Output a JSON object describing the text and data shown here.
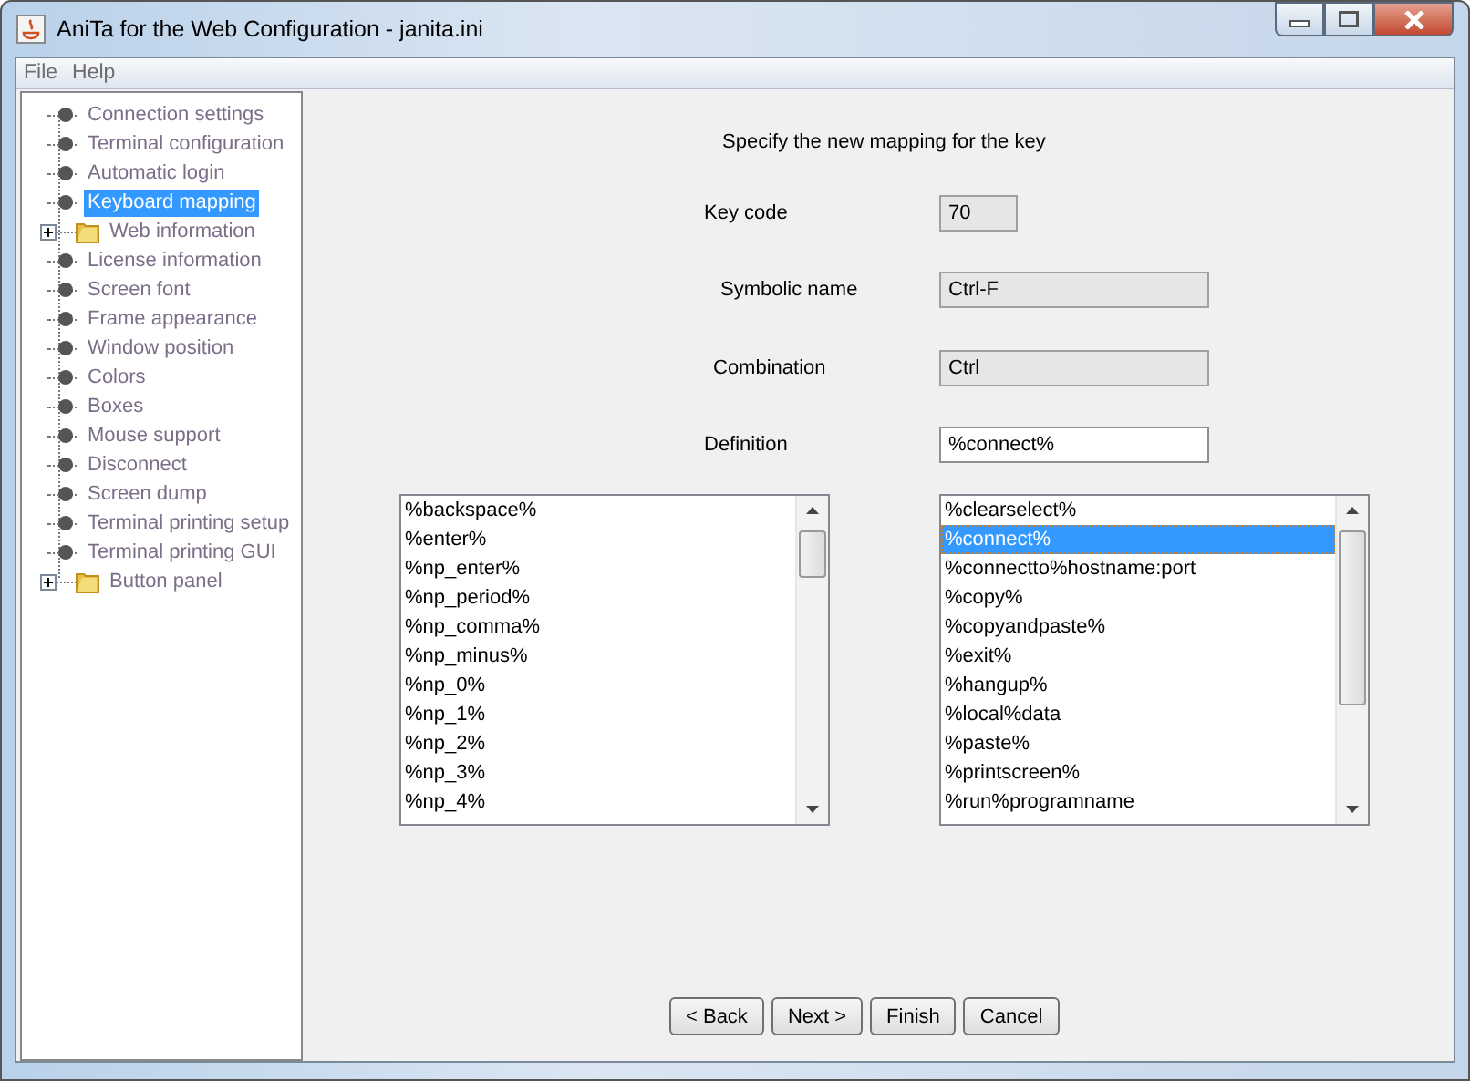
{
  "window": {
    "title": "AniTa for the Web Configuration - janita.ini"
  },
  "menu": [
    "File",
    "Help"
  ],
  "tree": [
    {
      "label": "Connection settings",
      "kind": "leaf",
      "selected": false
    },
    {
      "label": "Terminal configuration",
      "kind": "leaf",
      "selected": false
    },
    {
      "label": "Automatic login",
      "kind": "leaf",
      "selected": false
    },
    {
      "label": "Keyboard mapping",
      "kind": "leaf",
      "selected": true
    },
    {
      "label": "Web information",
      "kind": "folder",
      "expanded": false,
      "selected": false
    },
    {
      "label": "License information",
      "kind": "leaf",
      "selected": false
    },
    {
      "label": "Screen font",
      "kind": "leaf",
      "selected": false
    },
    {
      "label": "Frame appearance",
      "kind": "leaf",
      "selected": false
    },
    {
      "label": "Window position",
      "kind": "leaf",
      "selected": false
    },
    {
      "label": "Colors",
      "kind": "leaf",
      "selected": false
    },
    {
      "label": "Boxes",
      "kind": "leaf",
      "selected": false
    },
    {
      "label": "Mouse support",
      "kind": "leaf",
      "selected": false
    },
    {
      "label": "Disconnect",
      "kind": "leaf",
      "selected": false
    },
    {
      "label": "Screen dump",
      "kind": "leaf",
      "selected": false
    },
    {
      "label": "Terminal printing setup",
      "kind": "leaf",
      "selected": false
    },
    {
      "label": "Terminal printing GUI",
      "kind": "leaf",
      "selected": false
    },
    {
      "label": "Button panel",
      "kind": "folder",
      "expanded": false,
      "selected": false
    }
  ],
  "form": {
    "heading": "Specify the new mapping for the key",
    "fields": [
      {
        "label": "Key code",
        "value": "70",
        "disabled": true
      },
      {
        "label": "Symbolic name",
        "value": "Ctrl-F",
        "disabled": true
      },
      {
        "label": "Combination",
        "value": "Ctrl",
        "disabled": true
      },
      {
        "label": "Definition",
        "value": "%connect%",
        "disabled": false
      }
    ]
  },
  "lists": [
    {
      "items": [
        {
          "text": "%backspace%",
          "selected": false
        },
        {
          "text": "%enter%",
          "selected": false
        },
        {
          "text": "%np_enter%",
          "selected": false
        },
        {
          "text": "%np_period%",
          "selected": false
        },
        {
          "text": "%np_comma%",
          "selected": false
        },
        {
          "text": "%np_minus%",
          "selected": false
        },
        {
          "text": "%np_0%",
          "selected": false
        },
        {
          "text": "%np_1%",
          "selected": false
        },
        {
          "text": "%np_2%",
          "selected": false
        },
        {
          "text": "%np_3%",
          "selected": false
        },
        {
          "text": "%np_4%",
          "selected": false
        }
      ]
    },
    {
      "items": [
        {
          "text": "%clearselect%",
          "selected": false
        },
        {
          "text": "%connect%",
          "selected": true
        },
        {
          "text": "%connectto%hostname:port",
          "selected": false
        },
        {
          "text": "%copy%",
          "selected": false
        },
        {
          "text": "%copyandpaste%",
          "selected": false
        },
        {
          "text": "%exit%",
          "selected": false
        },
        {
          "text": "%hangup%",
          "selected": false
        },
        {
          "text": "%local%data",
          "selected": false
        },
        {
          "text": "%paste%",
          "selected": false
        },
        {
          "text": "%printscreen%",
          "selected": false
        },
        {
          "text": "%run%programname",
          "selected": false
        }
      ]
    }
  ],
  "buttons": [
    "< Back",
    "Next >",
    "Finish",
    "Cancel"
  ]
}
